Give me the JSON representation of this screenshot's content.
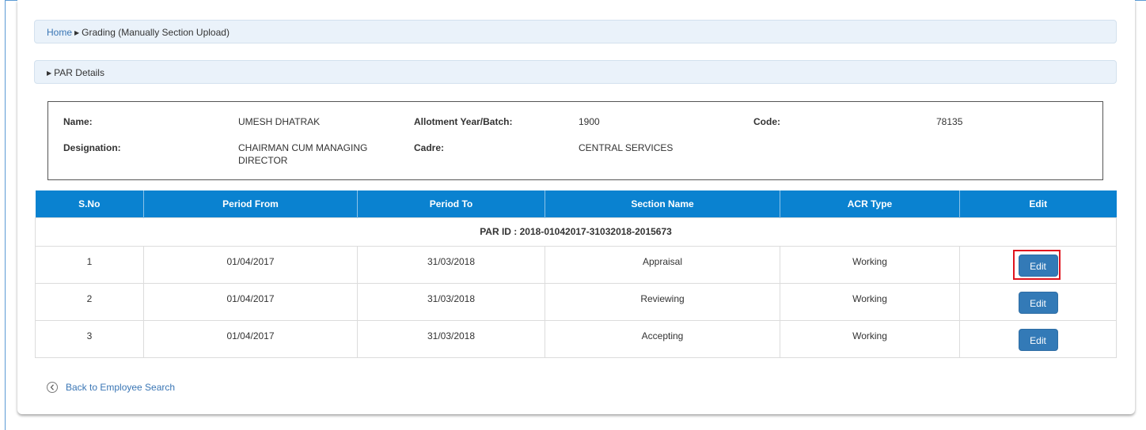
{
  "breadcrumb": {
    "home": "Home",
    "current": "Grading (Manually Section Upload)"
  },
  "section_header": "PAR Details",
  "employee": {
    "name_label": "Name:",
    "name": "UMESH DHATRAK",
    "batch_label": "Allotment Year/Batch:",
    "batch": "1900",
    "code_label": "Code:",
    "code": "78135",
    "designation_label": "Designation:",
    "designation": "CHAIRMAN CUM MANAGING DIRECTOR",
    "cadre_label": "Cadre:",
    "cadre": "CENTRAL SERVICES"
  },
  "table": {
    "headers": [
      "S.No",
      "Period From",
      "Period To",
      "Section Name",
      "ACR Type",
      "Edit"
    ],
    "par_id": "PAR ID : 2018-01042017-31032018-2015673",
    "rows": [
      {
        "sno": "1",
        "from": "01/04/2017",
        "to": "31/03/2018",
        "section": "Appraisal",
        "acr": "Working",
        "edit": "Edit"
      },
      {
        "sno": "2",
        "from": "01/04/2017",
        "to": "31/03/2018",
        "section": "Reviewing",
        "acr": "Working",
        "edit": "Edit"
      },
      {
        "sno": "3",
        "from": "01/04/2017",
        "to": "31/03/2018",
        "section": "Accepting",
        "acr": "Working",
        "edit": "Edit"
      }
    ]
  },
  "back_link": "Back to Employee Search",
  "colors": {
    "header_blue": "#0a82d0",
    "button_blue": "#337ab7",
    "link_blue": "#3a76b5",
    "highlight_red": "#e0141e"
  }
}
